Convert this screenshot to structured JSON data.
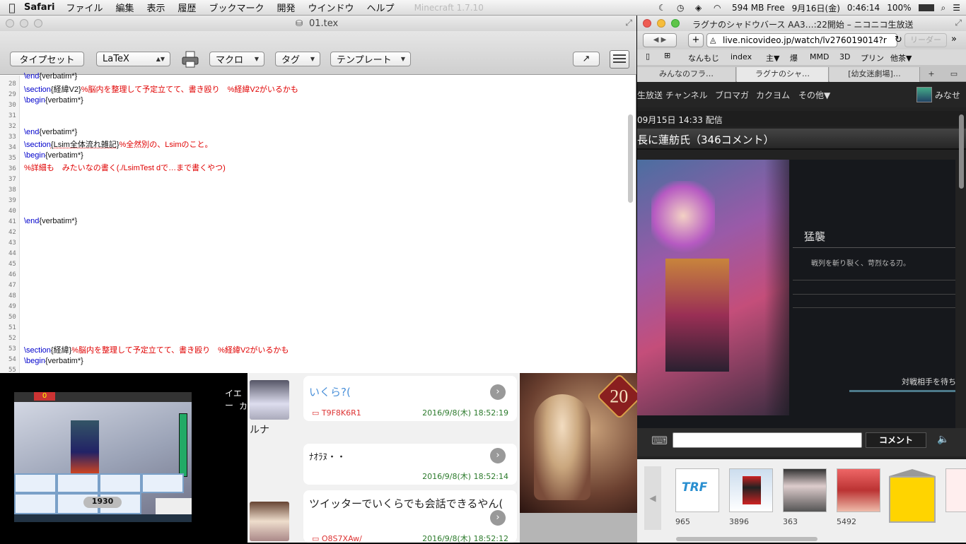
{
  "menubar": {
    "apple": "",
    "app_name": "Safari",
    "items": [
      "ファイル",
      "編集",
      "表示",
      "履歴",
      "ブックマーク",
      "開発",
      "ウインドウ",
      "ヘルプ"
    ],
    "ghost_title": "Minecraft 1.7.10",
    "memory": "594 MB Free",
    "date": "9月16日(金)",
    "time": "0:46:14",
    "battery": "100%"
  },
  "editor": {
    "title": "01.tex",
    "toolbar": {
      "typeset": "タイプセット",
      "engine": "LaTeX",
      "macro": "マクロ",
      "tag": "タグ",
      "template": "テンプレート"
    },
    "line_numbers": [
      "28",
      "29",
      "30",
      "31",
      "32",
      "33",
      "34",
      "35",
      "36",
      "37",
      "38",
      "39",
      "40",
      "41",
      "42",
      "43",
      "44",
      "45",
      "46",
      "47",
      "48",
      "49",
      "50",
      "51",
      "52",
      "53",
      "54",
      "55"
    ],
    "lines": {
      "l29_cmd": "\\end",
      "l29_arg": "{verbatim*}",
      "l30_cmd": "\\section",
      "l30_arg": "{経緯V2}",
      "l30_comment": "%脳内を整理して予定立てて、書き殴り　%経緯V2がいるかも",
      "l31_cmd": "\\begin",
      "l31_arg": "{verbatim*}",
      "l34_cmd": "\\end",
      "l34_arg": "{verbatim*}",
      "l35_cmd": "\\section",
      "l35_arg": "{Lsim全体流れ雑記}",
      "l35_comment": "%全然別の、Lsimのこと。",
      "l36_cmd": "\\begin",
      "l36_arg": "{verbatim*}",
      "l37_comment": "%詳細も　みたいなの書く(./LsimTest dで…まで書くやつ)",
      "l42_cmd": "\\end",
      "l42_arg": "{verbatim*}",
      "l54_cmd": "\\section",
      "l54_arg": "{経緯}",
      "l54_comment": "%脳内を整理して予定立てて、書き殴り　%経緯V2がいるかも",
      "l55_cmd": "\\begin",
      "l55_arg": "{verbatim*}"
    }
  },
  "game": {
    "hp": "1930",
    "top_counter": "0",
    "side_text_1": "イエー",
    "side_text_2": "カ"
  },
  "chat": {
    "user_name": "ルナ",
    "messages": [
      {
        "text": "いくら?(",
        "id": "T9F8K6R1",
        "time": "2016/9/8(木) 18:52:19"
      },
      {
        "text": "ﾅｵﾗﾇ・・",
        "id": "",
        "time": "2016/9/8(木) 18:52:14"
      },
      {
        "text": "ツイッターでいくらでも会話できるやん(",
        "id": "O8S7XAw/",
        "time": "2016/9/8(木) 18:52:12"
      }
    ]
  },
  "cardart": {
    "badge": "20"
  },
  "browser": {
    "title": "ラグナのシャドウバース AA3…:22開始 – ニコニコ生放送",
    "url": "live.nicovideo.jp/watch/lv276019014?r",
    "reader": "リーダー",
    "bookmarks": [
      "なんもじ",
      "index",
      "主▼",
      "爆",
      "MMD",
      "3D",
      "プリン",
      "他茶▼"
    ],
    "tabs": [
      "みんなのフラ…",
      "ラグナのシャ…",
      "[幼女迷劇場]…"
    ],
    "nico_nav": [
      "生放送",
      "チャンネル",
      "ブロマガ",
      "カクヨム",
      "その他▼"
    ],
    "nico_user": "みなせ",
    "broadcast_date": "09月15日 14:33 配信",
    "heading": "長に蓮舫氏（346コメント）",
    "player": {
      "card_name": "猛襲",
      "card_desc": "戦列を斬り裂く、苛烈なる刃。",
      "waiting": "対戦相手を待ち"
    },
    "comment_button": "コメント",
    "thumb_counts": [
      "965",
      "3896",
      "363",
      "5492"
    ],
    "thumb_labels": [
      "TRF"
    ]
  }
}
